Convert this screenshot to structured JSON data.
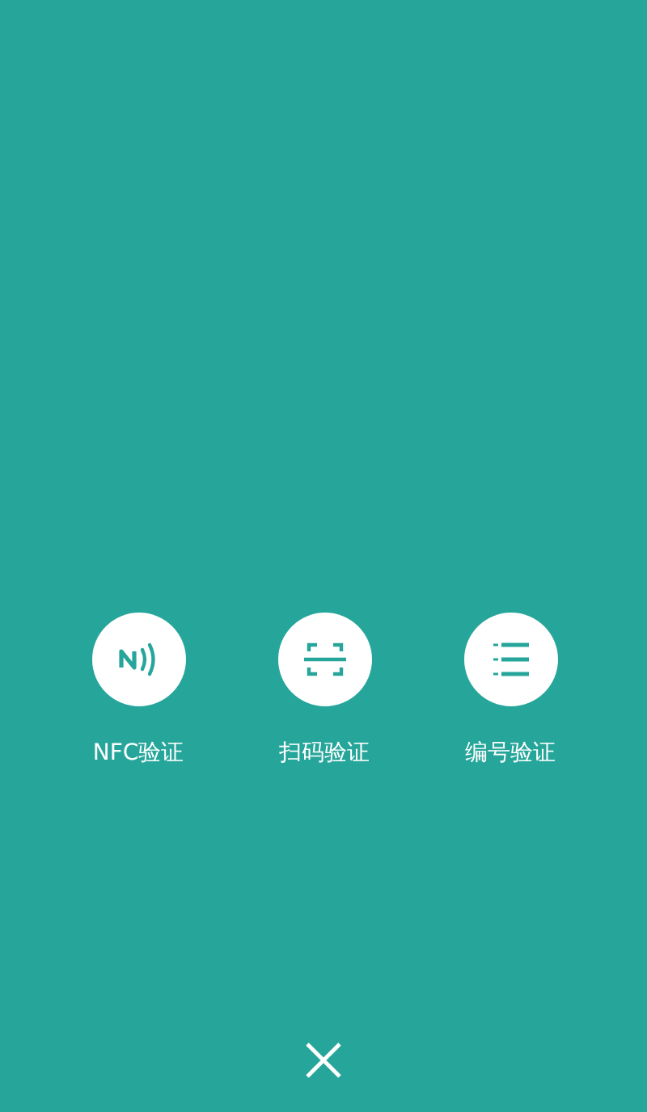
{
  "options": [
    {
      "kind": "nfc",
      "label": "NFC验证"
    },
    {
      "kind": "scan",
      "label": "扫码验证"
    },
    {
      "kind": "number",
      "label": "编号验证"
    }
  ]
}
